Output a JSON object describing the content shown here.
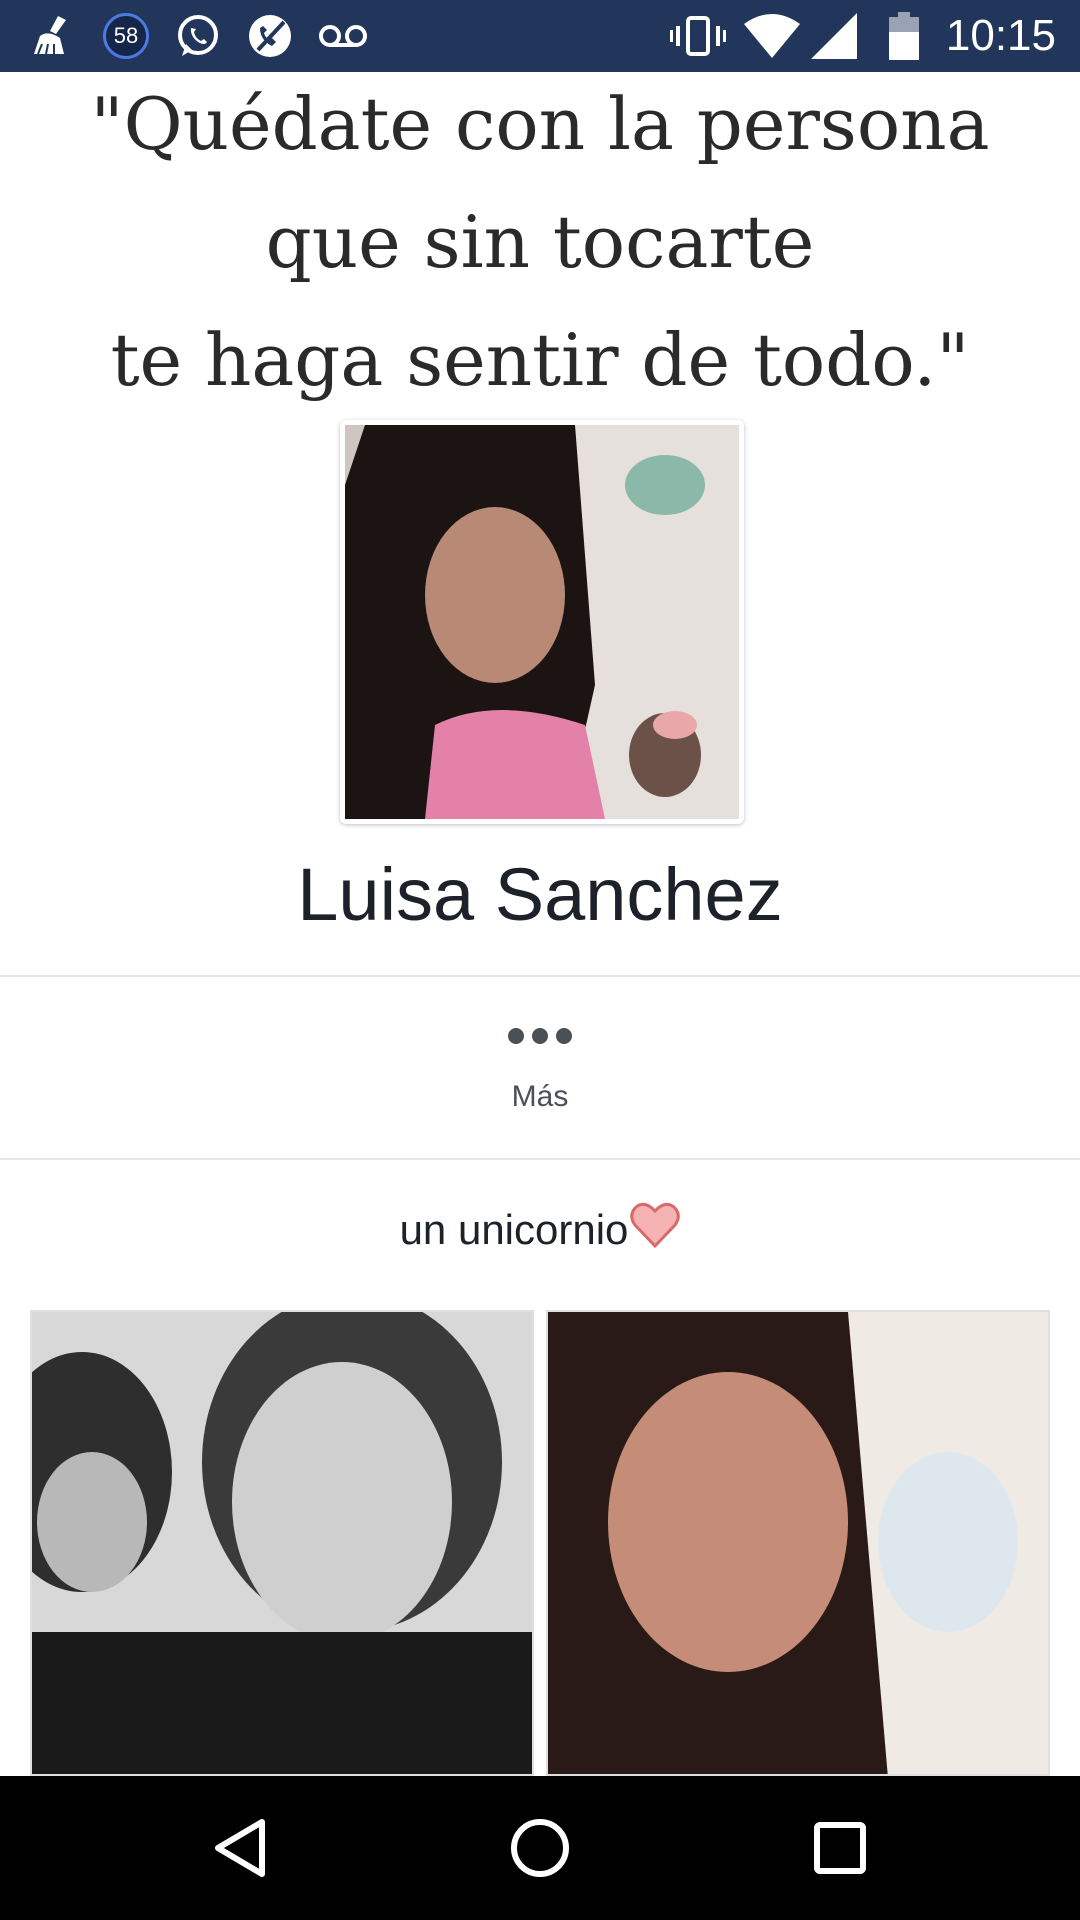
{
  "status_bar": {
    "notification_badge": "58",
    "time": "10:15",
    "icons": [
      "broom-icon",
      "whatsapp-icon",
      "blocked-call-icon",
      "voicemail-icon",
      "vibrate-icon",
      "wifi-icon",
      "signal-icon",
      "battery-icon"
    ]
  },
  "cover": {
    "quote_line_1": "\"Quédate con la persona",
    "quote_line_2": "que sin tocarte",
    "quote_line_3": "te haga sentir de todo.\""
  },
  "profile": {
    "name": "Luisa Sanchez",
    "more_label": "Más",
    "bio_text": "un unicornio"
  },
  "nav": {
    "icons": [
      "back-icon",
      "home-icon",
      "recents-icon"
    ]
  },
  "colors": {
    "status_bar": "#22355b",
    "nav_bar": "#000000",
    "heart": "#f08a8a"
  }
}
